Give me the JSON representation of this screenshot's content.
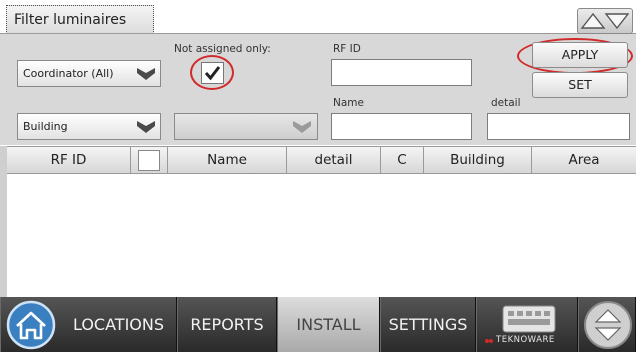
{
  "tab": {
    "label": "Filter luminaires"
  },
  "filters": {
    "coordinator": {
      "value": "Coordinator (All)"
    },
    "not_assigned_label": "Not assigned only:",
    "not_assigned_checked": true,
    "rfid_label": "RF ID",
    "rfid_value": "",
    "building": {
      "value": "Building"
    },
    "sub_select": {
      "value": ""
    },
    "name_label": "Name",
    "name_value": "",
    "detail_label": "detail",
    "detail_value": ""
  },
  "buttons": {
    "apply": "APPLY",
    "set": "SET"
  },
  "table": {
    "columns": [
      "RF ID",
      "",
      "Name",
      "detail",
      "C",
      "Building",
      "Area"
    ],
    "rows": []
  },
  "nav": {
    "items": [
      "LOCATIONS",
      "REPORTS",
      "INSTALL",
      "SETTINGS"
    ],
    "active": "INSTALL",
    "brand": "TEKNOWARE"
  },
  "icons": {
    "home": "home-icon",
    "keyboard": "keyboard-icon",
    "scroll": "up-down-arrows-icon",
    "dropdown": "chevron-down-icon",
    "check": "check-icon"
  },
  "colors": {
    "highlight_ring": "#d02a2a",
    "panel_bg": "#d8d8d8",
    "nav_bg": "#2a2a2a",
    "home_blue": "#3a7fc0"
  }
}
